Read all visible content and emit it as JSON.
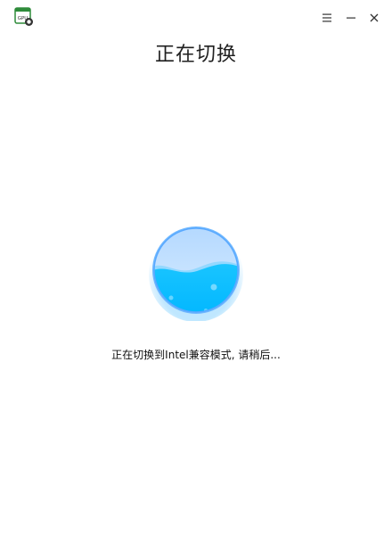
{
  "app": {
    "icon_name": "gpu-switch-icon",
    "icon_text": "GPU"
  },
  "window_controls": {
    "menu_icon": "hamburger-menu-icon",
    "minimize_icon": "minimize-icon",
    "close_icon": "close-icon"
  },
  "header": {
    "title": "正在切换"
  },
  "progress_orb": {
    "icon_name": "water-orb-icon",
    "fill_fraction": 0.55,
    "colors": {
      "water": "#00bfff",
      "water_light": "#7fd9ff",
      "glass": "#c7e6ff",
      "rim": "#4fb3ff"
    }
  },
  "status": {
    "message": "正在切换到Intel兼容模式, 请稍后..."
  }
}
